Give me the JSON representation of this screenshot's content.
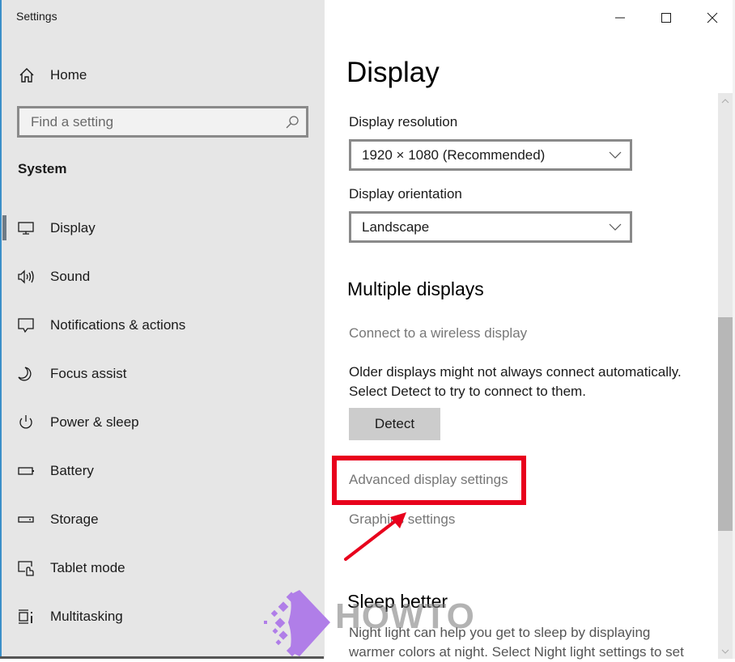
{
  "window": {
    "title": "Settings",
    "controls": {
      "minimize": "minimize-icon",
      "maximize": "maximize-icon",
      "close": "close-icon"
    }
  },
  "sidebar": {
    "home": {
      "label": "Home",
      "icon": "home-icon"
    },
    "search": {
      "placeholder": "Find a setting",
      "value": "",
      "icon": "search-icon"
    },
    "section_title": "System",
    "items": [
      {
        "label": "Display",
        "icon": "monitor-icon",
        "active": true
      },
      {
        "label": "Sound",
        "icon": "speaker-icon",
        "active": false
      },
      {
        "label": "Notifications & actions",
        "icon": "notification-icon",
        "active": false
      },
      {
        "label": "Focus assist",
        "icon": "moon-icon",
        "active": false
      },
      {
        "label": "Power & sleep",
        "icon": "power-icon",
        "active": false
      },
      {
        "label": "Battery",
        "icon": "battery-icon",
        "active": false
      },
      {
        "label": "Storage",
        "icon": "storage-icon",
        "active": false
      },
      {
        "label": "Tablet mode",
        "icon": "tablet-mode-icon",
        "active": false
      },
      {
        "label": "Multitasking",
        "icon": "multitasking-icon",
        "active": false
      }
    ]
  },
  "main": {
    "title": "Display",
    "resolution": {
      "label": "Display resolution",
      "value": "1920 × 1080 (Recommended)"
    },
    "orientation": {
      "label": "Display orientation",
      "value": "Landscape"
    },
    "multiple_displays": {
      "heading": "Multiple displays",
      "wireless_link": "Connect to a wireless display",
      "description_line1": "Older displays might not always connect automatically.",
      "description_line2": "Select Detect to try to connect to them.",
      "detect_button": "Detect",
      "advanced_link": "Advanced display settings",
      "graphics_link": "Graphics settings"
    },
    "sleep_better": {
      "heading": "Sleep better",
      "line1": "Night light can help you get to sleep by displaying",
      "line2": "warmer colors at night. Select Night light settings to set"
    }
  },
  "annotation": {
    "highlight_color": "#e8001c",
    "highlight_target": "Advanced display settings"
  },
  "watermark": {
    "text": "HOWTO",
    "color": "#b07ee8"
  }
}
